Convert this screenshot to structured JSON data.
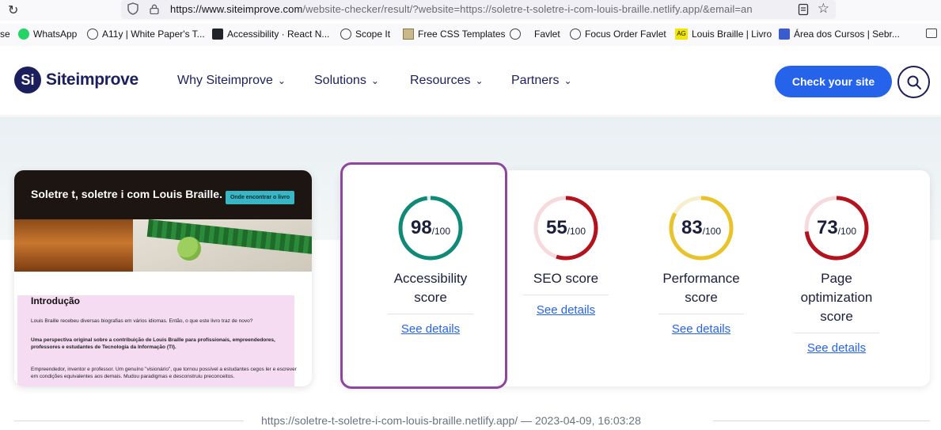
{
  "browser": {
    "url_host": "https://www.siteimprove.com",
    "url_rest": "/website-checker/result/?website=https://soletre-t-soletre-i-com-louis-braille.netlify.app/&email=an",
    "bookmarks": [
      {
        "label": "se",
        "icon": "none"
      },
      {
        "label": "WhatsApp",
        "icon": "whatsapp-icon"
      },
      {
        "label": "A11y | White Paper's T...",
        "icon": "globe-icon"
      },
      {
        "label": "Accessibility · React N...",
        "icon": "react-icon"
      },
      {
        "label": "Scope It",
        "icon": "globe-icon"
      },
      {
        "label": "Free CSS Templates",
        "icon": "image-icon"
      },
      {
        "label": "Favlet",
        "icon": "globe-icon"
      },
      {
        "label": "Focus Order Favlet",
        "icon": "globe-icon"
      },
      {
        "label": "Louis Braille | Livro",
        "icon": "ag-icon"
      },
      {
        "label": "Área dos Cursos | Sebr...",
        "icon": "course-icon"
      }
    ]
  },
  "header": {
    "logo_mark": "Si",
    "logo_text": "Siteimprove",
    "nav": [
      "Why Siteimprove",
      "Solutions",
      "Resources",
      "Partners"
    ],
    "cta": "Check your site"
  },
  "preview": {
    "site_title": "Soletre t, soletre i com Louis Braille.",
    "button": "Onde encontrar o livro",
    "heading": "Introdução",
    "p1": "Louis Braille recebeu diversas biografias em vários idiomas. Então, o que este livro traz de novo?",
    "p2": "Uma perspectiva original sobre a contribuição de Louis Braille para profissionais, empreendedores, professores e estudantes de Tecnologia da Informação (TI).",
    "p3": "Empreendedor, inventor e professor. Um genuíno \"visionário\", que tornou possível a estudantes cegos ler e escrever em condições equivalentes aos demais. Mudou paradigmas e desconstruiu preconceitos."
  },
  "scores": [
    {
      "value": "98",
      "max": "/100",
      "label": "Accessibility score",
      "link": "See details",
      "color": "#0f8a76",
      "track": "#d8ece8",
      "fraction": 0.98
    },
    {
      "value": "55",
      "max": "/100",
      "label": "SEO score",
      "link": "See details",
      "color": "#b4121c",
      "track": "#f6dadd",
      "fraction": 0.55
    },
    {
      "value": "83",
      "max": "/100",
      "label": "Performance score",
      "link": "See details",
      "color": "#e9c32a",
      "track": "#f7eecb",
      "fraction": 0.83
    },
    {
      "value": "73",
      "max": "/100",
      "label": "Page optimization score",
      "link": "See details",
      "color": "#b4121c",
      "track": "#f6dadd",
      "fraction": 0.73
    }
  ],
  "meta": {
    "text": "https://soletre-t-soletre-i-com-louis-braille.netlify.app/ — 2023-04-09, 16:03:28"
  }
}
